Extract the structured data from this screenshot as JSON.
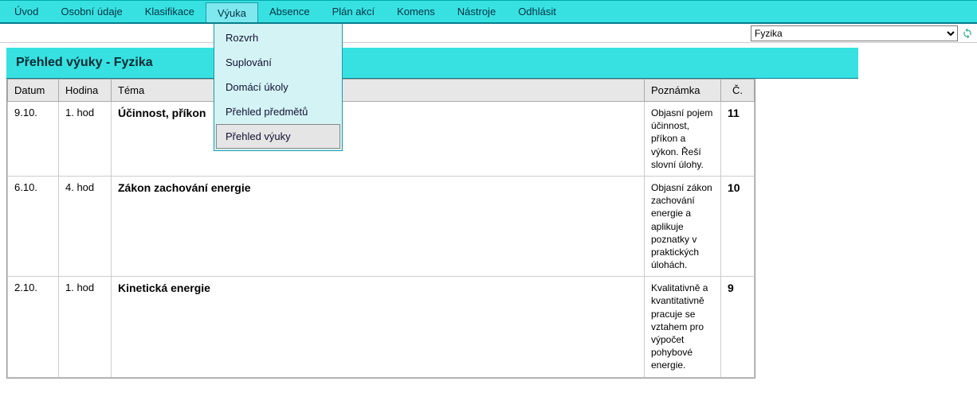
{
  "menu": {
    "items": [
      "Úvod",
      "Osobní údaje",
      "Klasifikace",
      "Výuka",
      "Absence",
      "Plán akcí",
      "Komens",
      "Nástroje",
      "Odhlásit"
    ],
    "active_index": 3,
    "dropdown": {
      "items": [
        "Rozvrh",
        "Suplování",
        "Domácí úkoly",
        "Přehled předmětů",
        "Přehled výuky"
      ],
      "highlight_index": 4
    }
  },
  "subject_select": {
    "value": "Fyzika"
  },
  "page_title": "Přehled výuky - Fyzika",
  "table": {
    "headers": {
      "date": "Datum",
      "hour": "Hodina",
      "topic": "Téma",
      "note": "Poznámka",
      "num": "Č."
    },
    "rows": [
      {
        "date": "9.10.",
        "hour": "1. hod",
        "topic": "Účinnost, příkon",
        "note": "Objasní pojem účinnost, příkon a výkon. Řeší slovní úlohy.",
        "num": "11"
      },
      {
        "date": "6.10.",
        "hour": "4. hod",
        "topic": "Zákon zachování energie",
        "note": "Objasní zákon zachování energie a aplikuje poznatky v praktických úlohách.",
        "num": "10"
      },
      {
        "date": "2.10.",
        "hour": "1. hod",
        "topic": "Kinetická energie",
        "note": "Kvalitativně a kvantitativně pracuje se vztahem pro výpočet pohybové energie.",
        "num": "9"
      }
    ]
  }
}
